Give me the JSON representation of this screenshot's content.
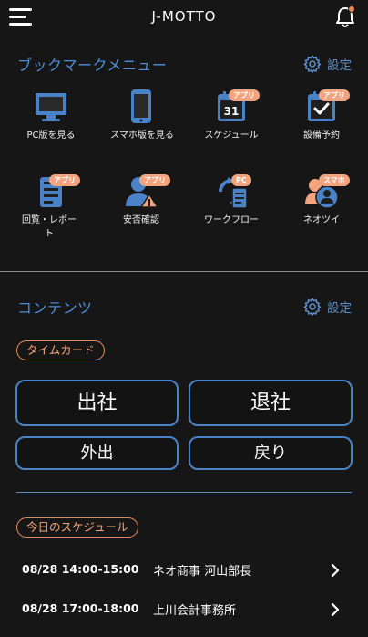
{
  "header": {
    "title": "J-MOTTO",
    "menu_icon": "hamburger-icon",
    "notification_icon": "bell-icon"
  },
  "bookmark": {
    "title": "ブックマークメニュー",
    "settings_label": "設定",
    "items": [
      {
        "label": "PC版を見る",
        "icon": "monitor-icon",
        "badge": ""
      },
      {
        "label": "スマホ版を見る",
        "icon": "smartphone-icon",
        "badge": ""
      },
      {
        "label": "スケジュール",
        "icon": "calendar-icon",
        "badge": "アプリ",
        "icon_text": "31"
      },
      {
        "label": "設備予約",
        "icon": "calendar-check-icon",
        "badge": "アプリ"
      },
      {
        "label": "回覧・レポート",
        "icon": "document-icon",
        "badge": "アプリ"
      },
      {
        "label": "安否確認",
        "icon": "person-alert-icon",
        "badge": "アプリ"
      },
      {
        "label": "ワークフロー",
        "icon": "workflow-icon",
        "badge": "PC"
      },
      {
        "label": "ネオツイ",
        "icon": "people-icon",
        "badge": "スマホ"
      }
    ]
  },
  "contents": {
    "title": "コンテンツ",
    "settings_label": "設定"
  },
  "timecard": {
    "label": "タイムカード",
    "buttons": {
      "clock_in": "出社",
      "clock_out": "退社",
      "go_out": "外出",
      "return": "戻り"
    }
  },
  "schedule": {
    "label": "今日のスケジュール",
    "items": [
      {
        "time": "08/28 14:00-15:00",
        "title": "ネオ商事 河山部長"
      },
      {
        "time": "08/28 17:00-18:00",
        "title": "上川会計事務所"
      }
    ]
  },
  "colors": {
    "background": "#161616",
    "accent_blue": "#4d8ed8",
    "accent_orange": "#f3a37d"
  }
}
